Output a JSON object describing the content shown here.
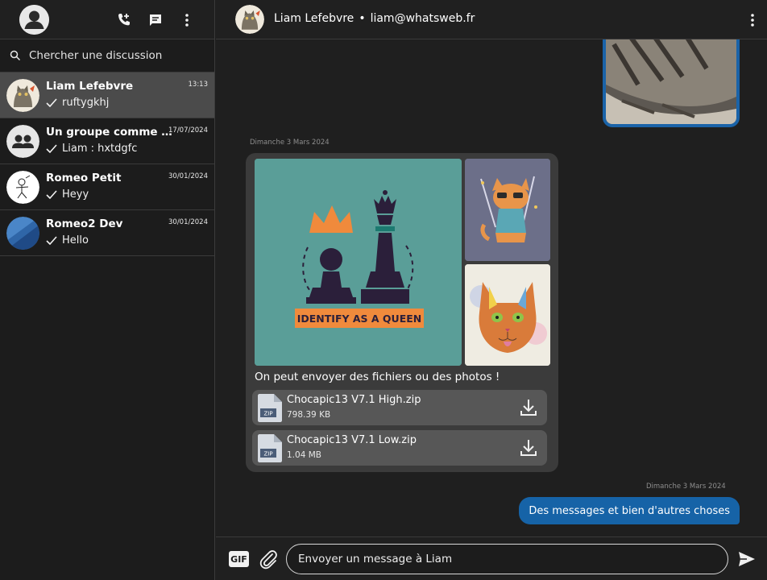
{
  "sidebar": {
    "search_placeholder": "Chercher une discussion",
    "conversations": [
      {
        "name": "Liam Lefebvre",
        "time": "13:13",
        "last": "ruftygkhj",
        "active": true
      },
      {
        "name": "Un groupe comme un autre",
        "time": "17/07/2024",
        "last": "Liam : hxtdgfc"
      },
      {
        "name": "Romeo Petit",
        "time": "30/01/2024",
        "last": "Heyy"
      },
      {
        "name": "Romeo2 Dev",
        "time": "30/01/2024",
        "last": "Hello"
      }
    ]
  },
  "chat": {
    "contact_name": "Liam Lefebvre",
    "separator": "•",
    "contact_email": "liam@whatsweb.fr",
    "date_separator_1": "Dimanche 3 Mars 2024",
    "date_separator_2": "Dimanche 3 Mars 2024",
    "media_caption": "On peut envoyer des fichiers ou des photos !",
    "image_text": "IDENTIFY AS A QUEEN",
    "files": [
      {
        "name": "Chocapic13 V7.1 High.zip",
        "size": "798.39 KB",
        "type": "ZIP"
      },
      {
        "name": "Chocapic13 V7.1 Low.zip",
        "size": "1.04 MB",
        "type": "ZIP"
      }
    ],
    "sent_message": "Des messages et bien d'autres choses"
  },
  "composer": {
    "gif_label": "GIF",
    "placeholder": "Envoyer un message à Liam"
  },
  "colors": {
    "accent_blue": "#1663a7",
    "bubble_gray": "#3b3b3b",
    "file_gray": "#575757",
    "active_conv": "#4b4b4b"
  },
  "icons": [
    "profile-icon",
    "add-call-icon",
    "new-chat-icon",
    "menu-dots-icon",
    "search-icon",
    "check-icon",
    "group-icon",
    "zip-file-icon",
    "download-icon",
    "gif-icon",
    "paperclip-icon",
    "send-icon"
  ]
}
